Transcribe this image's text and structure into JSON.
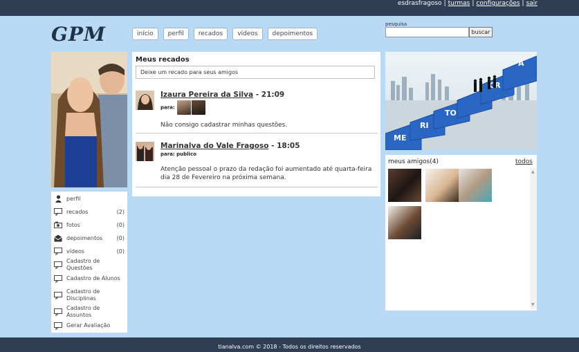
{
  "topbar": {
    "username": "esdrasfragoso",
    "links": [
      "turmas",
      "configurações",
      "sair"
    ],
    "separator": "|"
  },
  "logo": {
    "text": "GPM"
  },
  "nav": {
    "tabs": [
      "início",
      "perfil",
      "recados",
      "vídeos",
      "depoimentos"
    ]
  },
  "search": {
    "label": "pesquisa",
    "value": "",
    "button": "buscar"
  },
  "menu": {
    "items": [
      {
        "label": "perfil",
        "count": "",
        "icon": "person-icon"
      },
      {
        "label": "recados",
        "count": "(2)",
        "icon": "speech-bubble-icon"
      },
      {
        "label": "fotos",
        "count": "(0)",
        "icon": "photos-icon"
      },
      {
        "label": "depoimentos",
        "count": "(0)",
        "icon": "envelope-icon"
      },
      {
        "label": "vídeos",
        "count": "(0)",
        "icon": "video-icon"
      },
      {
        "label": "Cadastro de Questões",
        "count": "",
        "icon": "board-icon"
      },
      {
        "label": "Cadastro de Alunos",
        "count": "",
        "icon": "board-icon"
      },
      {
        "label": "Cadastro de Disciplinas",
        "count": "",
        "icon": "board-icon"
      },
      {
        "label": "Cadastro de Assuntos",
        "count": "",
        "icon": "board-icon"
      },
      {
        "label": "Gerar Avaliação",
        "count": "",
        "icon": "board-icon"
      }
    ]
  },
  "recados": {
    "heading": "Meus recados",
    "input_value": "Deixe um recado para seus amigos",
    "messages": [
      {
        "author": "Izaura Pereira da Silva",
        "time": "21:09",
        "to_label": "para:",
        "to_value": "",
        "text": "Não consigo cadastrar minhas questões."
      },
      {
        "author": "Marinalva do Vale Fragoso",
        "time": "18:05",
        "to_label": "para:",
        "to_value": "publico",
        "text": "Atenção pessoal o prazo da redação foi aumentado até quarta-feira dia 28 de Fevereiro na próxima semana."
      }
    ]
  },
  "banner": {
    "letters": [
      "ME",
      "RI",
      "TO",
      "CR",
      "A"
    ]
  },
  "friends": {
    "title": "meus amigos(4)",
    "all_link": "todos"
  },
  "footer": {
    "text": "tianalva.com © 2018 - Todos os direitos reservados"
  },
  "colors": {
    "background": "#b9d9f5",
    "bar": "#2e3e54",
    "banner_blue": "#2a66c4"
  }
}
